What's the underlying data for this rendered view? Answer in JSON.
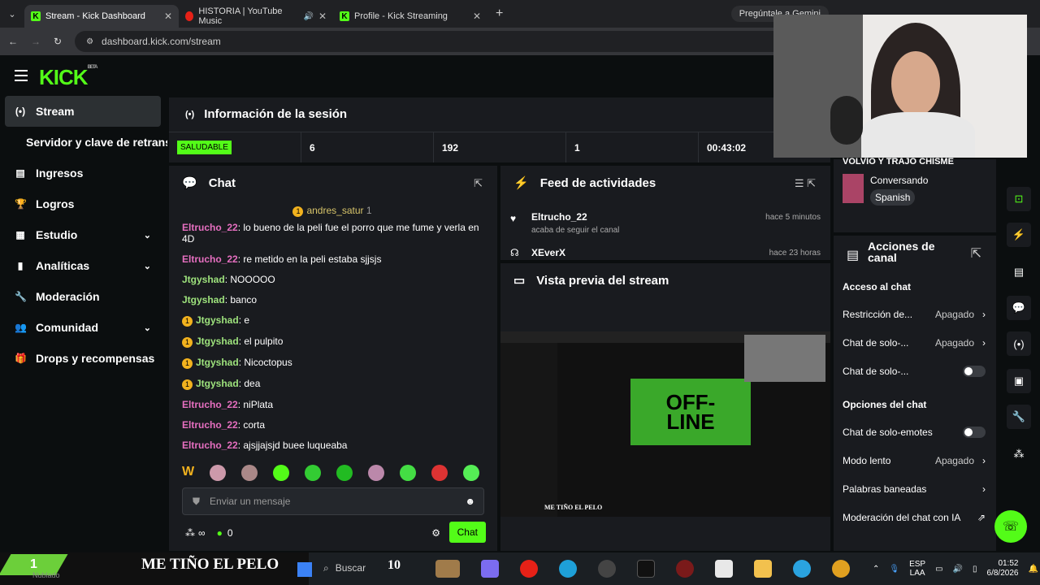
{
  "tabs": [
    {
      "label": "Stream - Kick Dashboard"
    },
    {
      "label": "HISTORIA | YouTube Music"
    },
    {
      "label": "Profile - Kick Streaming"
    }
  ],
  "gemini": "Pregúntale a Gemini",
  "url": "dashboard.kick.com/stream",
  "logo": "KICK",
  "logo_beta": "BETA",
  "sidebar": {
    "stream": "Stream",
    "servidor": "Servidor y clave de retransmisión",
    "ingresos": "Ingresos",
    "logros": "Logros",
    "estudio": "Estudio",
    "analiticas": "Analíticas",
    "moderacion": "Moderación",
    "comunidad": "Comunidad",
    "drops": "Drops y recompensas"
  },
  "session": {
    "title": "Información de la sesión",
    "status": "SALUDABLE",
    "s1": "6",
    "s2": "192",
    "s3": "1",
    "s4": "00:43:02"
  },
  "chat": {
    "title": "Chat",
    "pinned_user": "andres_satur",
    "pinned_count": "1",
    "messages": [
      {
        "user": "Eltrucho_22",
        "text": ": lo bueno de la peli fue el porro que me fume y verla en 4D",
        "color": "pink"
      },
      {
        "user": "Eltrucho_22",
        "text": ": re metido en la peli estaba sjjsjs",
        "color": "pink"
      },
      {
        "user": "Jtgyshad",
        "text": ": NOOOOO",
        "color": "green"
      },
      {
        "user": "Jtgyshad",
        "text": ": banco",
        "color": "green"
      },
      {
        "user": "Jtgyshad",
        "text": ": e",
        "color": "green",
        "coin": "1"
      },
      {
        "user": "Jtgyshad",
        "text": ": el pulpito",
        "color": "green",
        "coin": "1"
      },
      {
        "user": "Jtgyshad",
        "text": ": Nicoctopus",
        "color": "green",
        "coin": "1"
      },
      {
        "user": "Jtgyshad",
        "text": ": dea",
        "color": "green",
        "coin": "1"
      },
      {
        "user": "Eltrucho_22",
        "text": ": niPlata",
        "color": "pink"
      },
      {
        "user": "Eltrucho_22",
        "text": ": corta",
        "color": "pink"
      },
      {
        "user": "Eltrucho_22",
        "text": ": ajsjjajsjd buee luqueaba",
        "color": "pink"
      }
    ],
    "placeholder": "Enviar un mensaje",
    "viewers": "∞",
    "points": "0",
    "send": "Chat"
  },
  "feed": {
    "title": "Feed de actividades",
    "i1_user": "Eltrucho_22",
    "i1_action": "acaba de seguir el canal",
    "i1_time": "hace 5 minutos",
    "i2_user": "XEverX",
    "i2_time": "hace 23 horas"
  },
  "preview": {
    "title": "Vista previa del stream",
    "offline": "OFF-LINE",
    "overlay": "ME TIÑO EL PELO"
  },
  "stream_info": {
    "title": "VOLVIO Y TRAJO CHISME",
    "category": "Conversando",
    "lang": "Spanish"
  },
  "actions": {
    "title": "Acciones de canal",
    "acceso": "Acceso al chat",
    "r1": "Restricción de...",
    "r1v": "Apagado",
    "r2": "Chat de solo-...",
    "r2v": "Apagado",
    "r3": "Chat de solo-...",
    "opciones": "Opciones del chat",
    "r4": "Chat de solo-emotes",
    "r5": "Modo lento",
    "r5v": "Apagado",
    "r6": "Palabras baneadas",
    "r7": "Moderación del chat con IA"
  },
  "overlay": {
    "bottom": "ME TIÑO EL PELO",
    "number": "10",
    "badge": "1",
    "small": "Nublado"
  },
  "taskbar": {
    "search": "Buscar",
    "lang1": "ESP",
    "lang2": "LAA",
    "time": "01:52",
    "date": "6/8/2026"
  },
  "colors": {
    "accent": "#53fc18",
    "panel": "#191b1f"
  }
}
